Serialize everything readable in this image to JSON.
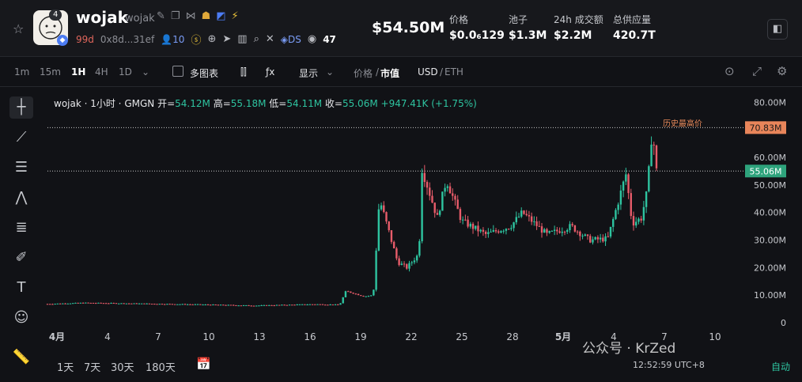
{
  "header": {
    "badge_count": "4",
    "token_name": "wojak",
    "token_symbol": "wojak",
    "age": "99d",
    "address": "0x8d...31ef",
    "holders": "10",
    "ds_label": "DS",
    "views": "47",
    "price": "$54.50M",
    "stats": [
      {
        "label": "价格",
        "value": "$0.0₆129"
      },
      {
        "label": "池子",
        "value": "$1.3M"
      },
      {
        "label": "24h 成交额",
        "value": "$2.2M"
      },
      {
        "label": "总供应量",
        "value": "420.7T"
      }
    ]
  },
  "toolbar": {
    "intervals": [
      "1m",
      "15m",
      "1H",
      "4H",
      "1D"
    ],
    "active_interval": "1H",
    "multi_chart": "多图表",
    "display": "显示",
    "price_label": "价格",
    "mcap_label": "市值",
    "usd": "USD",
    "eth": "ETH"
  },
  "legend": {
    "title": "wojak · 1小时 · GMGN",
    "open_label": "开=",
    "open": "54.12M",
    "high_label": "高=",
    "high": "55.18M",
    "low_label": "低=",
    "low": "54.11M",
    "close_label": "收=",
    "close": "55.06M",
    "change": "+947.41K (+1.75%)"
  },
  "chart_data": {
    "type": "candlestick",
    "ylim": [
      0,
      85
    ],
    "y_ticks": [
      "0",
      "10.00M",
      "20.00M",
      "30.00M",
      "40.00M",
      "50.00M",
      "60.00M",
      "70.00M",
      "80.00M"
    ],
    "x_ticks": [
      "4月",
      "4",
      "7",
      "10",
      "13",
      "16",
      "19",
      "22",
      "25",
      "28",
      "5月",
      "4",
      "7",
      "10"
    ],
    "ath_label": "历史最高价",
    "ath_value": "70.83M",
    "current_value": "55.06M",
    "ath": 70.83,
    "current": 55.06,
    "series": [
      {
        "x": "4月1",
        "y": 6.8
      },
      {
        "x": "4月3",
        "y": 7.2
      },
      {
        "x": "4月7",
        "y": 6.9
      },
      {
        "x": "4月10",
        "y": 6.6
      },
      {
        "x": "4月13",
        "y": 6.2
      },
      {
        "x": "4月16",
        "y": 6.7
      },
      {
        "x": "4月17",
        "y": 6.5
      },
      {
        "x": "4月18",
        "y": 11.5
      },
      {
        "x": "4月19",
        "y": 9.5
      },
      {
        "x": "4月20",
        "y": 10.0
      },
      {
        "x": "4月20b",
        "y": 45.0
      },
      {
        "x": "4月21",
        "y": 22.0
      },
      {
        "x": "4月21b",
        "y": 20.0
      },
      {
        "x": "4月22",
        "y": 25.0
      },
      {
        "x": "4月22b",
        "y": 56.0
      },
      {
        "x": "4月23",
        "y": 38.0
      },
      {
        "x": "4月24",
        "y": 52.0
      },
      {
        "x": "4月25",
        "y": 37.0
      },
      {
        "x": "4月26",
        "y": 32.0
      },
      {
        "x": "4月27",
        "y": 35.0
      },
      {
        "x": "4月28",
        "y": 40.0
      },
      {
        "x": "4月29",
        "y": 32.0
      },
      {
        "x": "4月30",
        "y": 35.0
      },
      {
        "x": "5月1",
        "y": 30.0
      },
      {
        "x": "5月2",
        "y": 30.5
      },
      {
        "x": "5月3",
        "y": 54.0
      },
      {
        "x": "5月4",
        "y": 36.0
      },
      {
        "x": "5月5",
        "y": 38.0
      },
      {
        "x": "5月6",
        "y": 48.0
      },
      {
        "x": "5月6b",
        "y": 70.83
      },
      {
        "x": "5月7",
        "y": 55.06
      }
    ]
  },
  "bottom": {
    "ranges": [
      "1天",
      "7天",
      "30天",
      "180天"
    ],
    "clock": "12:52:59 UTC+8",
    "watermark": "公众号 · KrZed",
    "auto": "自动"
  }
}
